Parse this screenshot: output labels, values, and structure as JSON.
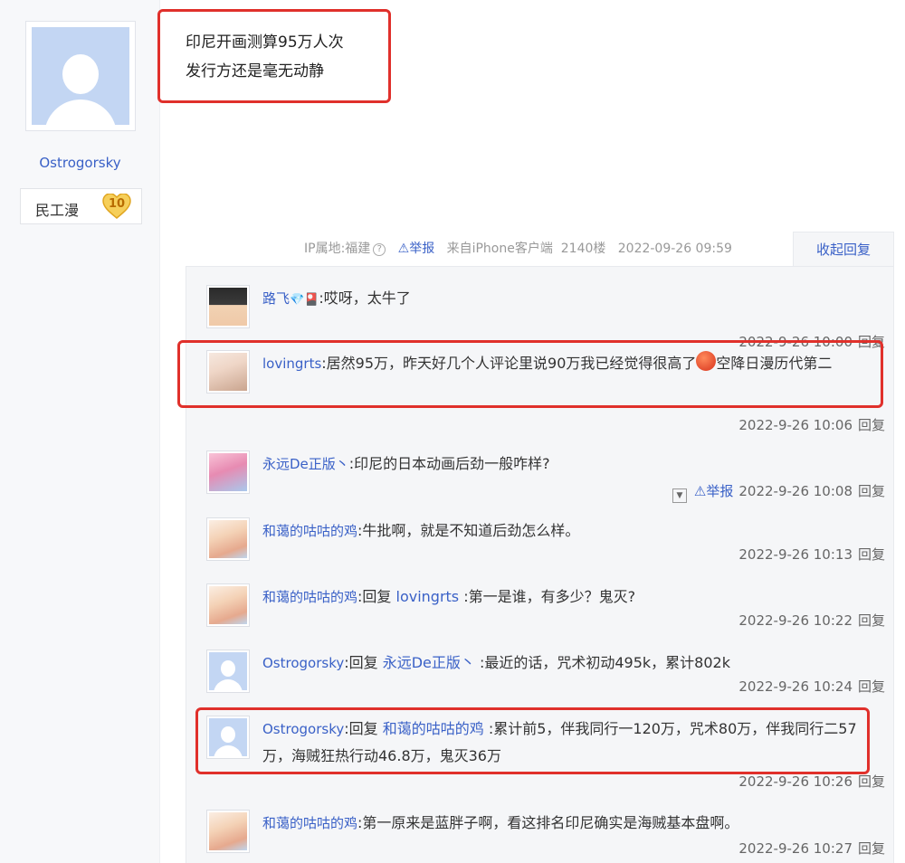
{
  "user": {
    "name": "Ostrogorsky",
    "level_title": "民工漫",
    "level_num": "10"
  },
  "post": {
    "line1": "印尼开画测算95万人次",
    "line2": "发行方还是毫无动静"
  },
  "meta": {
    "ip": "IP属地:福建",
    "help_icon": "?",
    "report": "⚠举报",
    "source": "来自iPhone客户端",
    "floor": "2140楼",
    "datetime": "2022-09-26 09:59",
    "collapse": "收起回复"
  },
  "comments": [
    {
      "nick": "路飞",
      "badges": "💎🎴",
      "text": ":哎呀，太牛了",
      "time": "2022-9-26 10:00",
      "reply": "回复"
    },
    {
      "nick": "lovingrts",
      "text": ":居然95万，昨天好几个人评论里说90万我已经觉得很高了",
      "text2": "空降日漫历代第二",
      "time": "2022-9-26 10:06",
      "reply": "回复"
    },
    {
      "nick": "永远De正版丶",
      "text": ":印尼的日本动画后劲一般咋样?",
      "time": "2022-9-26 10:08",
      "report": "⚠举报",
      "reply": "回复"
    },
    {
      "nick": "和蔼的咕咕的鸡",
      "text": ":牛批啊，就是不知道后劲怎么样。",
      "time": "2022-9-26 10:13",
      "reply": "回复"
    },
    {
      "nick": "和蔼的咕咕的鸡",
      "prefix": ":回复 ",
      "target": "lovingrts",
      "text": " :第一是谁，有多少？鬼灭?",
      "time": "2022-9-26 10:22",
      "reply": "回复"
    },
    {
      "nick": "Ostrogorsky",
      "prefix": ":回复 ",
      "target": "永远De正版丶",
      "text": " :最近的话，咒术初动495k，累计802k",
      "time": "2022-9-26 10:24",
      "reply": "回复"
    },
    {
      "nick": "Ostrogorsky",
      "prefix": ":回复 ",
      "target": "和蔼的咕咕的鸡",
      "text": " :累计前5，伴我同行一120万，咒术80万，伴我同行二57万，海贼狂热行动46.8万，鬼灭36万",
      "time": "2022-9-26 10:26",
      "reply": "回复"
    },
    {
      "nick": "和蔼的咕咕的鸡",
      "text": ":第一原来是蓝胖子啊，看这排名印尼确实是海贼基本盘啊。",
      "time": "2022-9-26 10:27",
      "reply": "回复"
    }
  ],
  "colors": {
    "link": "#3a61c7",
    "highlight_border": "#e0302b",
    "panel_bg": "#f5f6f8"
  }
}
